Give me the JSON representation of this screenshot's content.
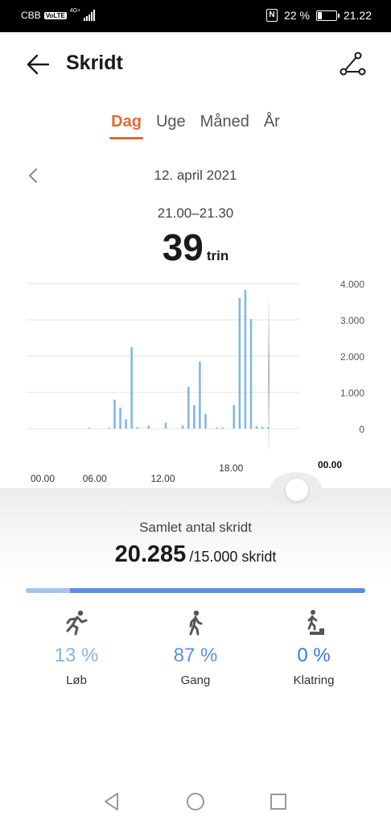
{
  "status_bar": {
    "carrier": "CBB",
    "volte": "VoLTE",
    "network": "4G+",
    "nfc": "N",
    "battery": "22 %",
    "battery_level": 0.22,
    "time": "21.22"
  },
  "header": {
    "title": "Skridt",
    "back_icon": "arrow-left-icon",
    "route_icon": "route-icon"
  },
  "tabs": [
    {
      "label": "Dag",
      "active": true
    },
    {
      "label": "Uge",
      "active": false
    },
    {
      "label": "Måned",
      "active": false
    },
    {
      "label": "År",
      "active": false
    }
  ],
  "date_nav": {
    "date": "12. april 2021",
    "prev_icon": "chevron-left-icon"
  },
  "selection": {
    "time_range": "21.00–21.30",
    "steps": "39",
    "unit": "trin"
  },
  "chart_data": {
    "type": "bar",
    "x_tick_labels": [
      "00.00",
      "06.00",
      "12.00",
      "18.00",
      "00.00"
    ],
    "y_tick_labels": [
      "4.000",
      "3.000",
      "2.000",
      "1.000",
      "0"
    ],
    "ylim": [
      0,
      4000
    ],
    "grid": true,
    "x_range_hours": [
      0,
      24
    ],
    "bar_width_hours": 0.5,
    "bar_color": "#82b7e8",
    "values": [
      {
        "start": 5.25,
        "value": 20
      },
      {
        "start": 7.0,
        "value": 20
      },
      {
        "start": 7.5,
        "value": 800
      },
      {
        "start": 8.0,
        "value": 580
      },
      {
        "start": 8.5,
        "value": 260
      },
      {
        "start": 9.0,
        "value": 2250
      },
      {
        "start": 9.5,
        "value": 40
      },
      {
        "start": 10.5,
        "value": 80
      },
      {
        "start": 12.0,
        "value": 160
      },
      {
        "start": 13.5,
        "value": 80
      },
      {
        "start": 14.0,
        "value": 1150
      },
      {
        "start": 14.5,
        "value": 650
      },
      {
        "start": 15.0,
        "value": 1850
      },
      {
        "start": 15.5,
        "value": 400
      },
      {
        "start": 16.5,
        "value": 30
      },
      {
        "start": 17.0,
        "value": 30
      },
      {
        "start": 18.0,
        "value": 650
      },
      {
        "start": 18.5,
        "value": 3600
      },
      {
        "start": 19.0,
        "value": 3830
      },
      {
        "start": 19.5,
        "value": 3020
      },
      {
        "start": 20.0,
        "value": 60
      },
      {
        "start": 20.5,
        "value": 50
      },
      {
        "start": 21.0,
        "value": 39
      }
    ],
    "selected_start": 21.0
  },
  "summary": {
    "label": "Samlet antal skridt",
    "total": "20.285",
    "goal": "/15.000 skridt",
    "goal_fraction": 1.0,
    "run_fraction": 0.13,
    "walk_fraction": 0.87
  },
  "activities": [
    {
      "name": "Løb",
      "percent": "13 %",
      "icon": "running-person-icon"
    },
    {
      "name": "Gang",
      "percent": "87 %",
      "icon": "walking-person-icon"
    },
    {
      "name": "Klatring",
      "percent": "0 %",
      "icon": "climbing-stairs-icon"
    }
  ],
  "navbar": {
    "back_icon": "triangle-back-icon",
    "home_icon": "circle-home-icon",
    "recents_icon": "square-recents-icon"
  },
  "colors": {
    "accent": "#e06a30",
    "bar": "#82b7e8",
    "progress_walk": "#5b8fdb"
  }
}
